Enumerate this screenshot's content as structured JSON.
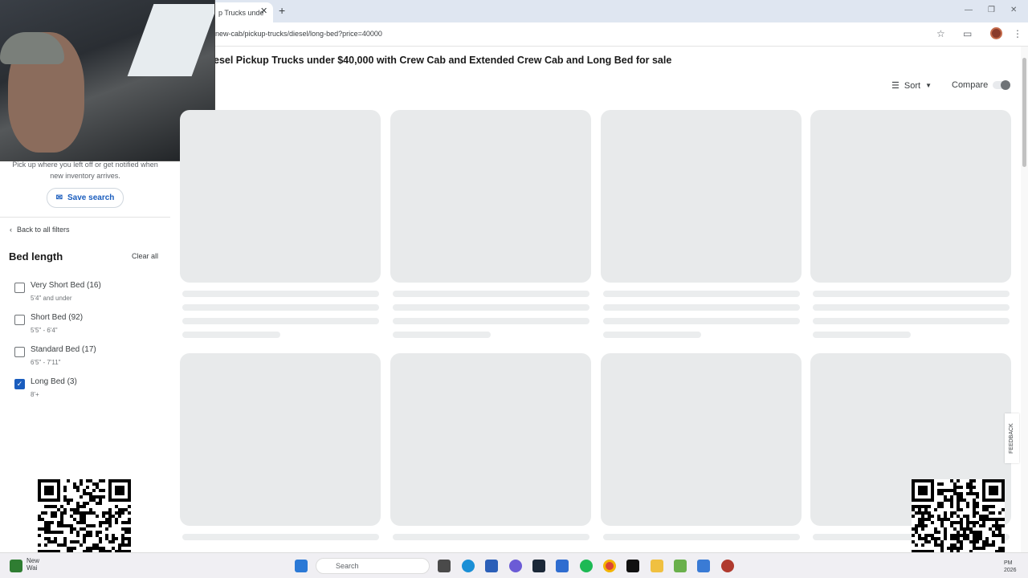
{
  "browser": {
    "tab_title": "p Trucks unde",
    "url": "new-cab/pickup-trucks/diesel/long-bed?price=40000"
  },
  "page": {
    "title": "esel Pickup Trucks under $40,000 with Crew Cab and Extended Crew Cab and Long Bed for sale",
    "sort_label": "Sort",
    "compare_label": "Compare"
  },
  "sidebar": {
    "save_text_line1": "Pick up where you left off or get notified when",
    "save_text_line2": "new inventory arrives.",
    "save_button": "Save search",
    "back_link": "Back to all filters",
    "filter_title": "Bed length",
    "clear_all": "Clear all",
    "options": [
      {
        "label": "Very Short Bed (16)",
        "sub": "5'4\" and under",
        "checked": false
      },
      {
        "label": "Short Bed (92)",
        "sub": "5'5\" - 6'4\"",
        "checked": false
      },
      {
        "label": "Standard Bed (17)",
        "sub": "6'5\" - 7'11\"",
        "checked": false
      },
      {
        "label": "Long Bed (3)",
        "sub": "8'+",
        "checked": true
      }
    ]
  },
  "feedback_label": "FEEDBACK",
  "taskbar": {
    "search_placeholder": "Search",
    "news_line1": "New",
    "news_line2": "Wai",
    "clock_line1": "PM",
    "clock_line2": "2026"
  },
  "colors": {
    "accent": "#1a5dbe",
    "skeleton": "#e8eaeb"
  }
}
